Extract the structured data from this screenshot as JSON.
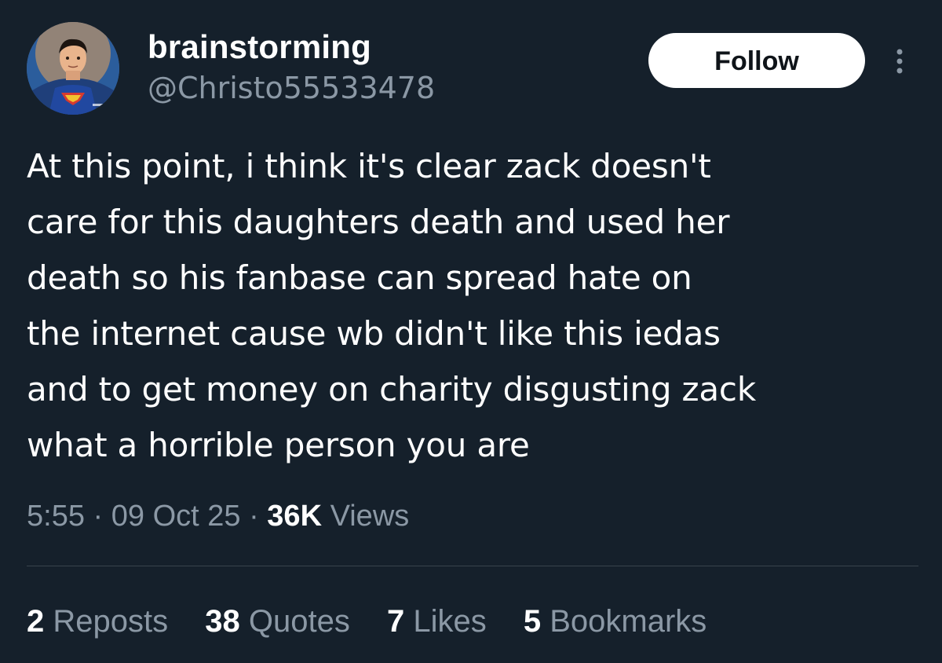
{
  "user": {
    "display_name": "brainstorming",
    "handle": "@Christo55533478",
    "avatar": "superman-avatar"
  },
  "actions": {
    "follow_label": "Follow",
    "more_icon": "more-vertical-icon"
  },
  "tweet": {
    "text": "At this point, i think it's clear zack doesn't\ncare for this daughters death and used her\ndeath so his fanbase can spread hate on\nthe internet cause wb didn't like this iedas\nand to get money on charity disgusting zack\nwhat a horrible person you are"
  },
  "meta": {
    "time": "5:55",
    "sep1": "·",
    "date": "09 Oct 25",
    "sep2": "·",
    "views_count": "36K",
    "views_label": "Views"
  },
  "stats": {
    "reposts_count": "2",
    "reposts_label": "Reposts",
    "quotes_count": "38",
    "quotes_label": "Quotes",
    "likes_count": "7",
    "likes_label": "Likes",
    "bookmarks_count": "5",
    "bookmarks_label": "Bookmarks"
  },
  "colors": {
    "background": "#15202b",
    "secondary_text": "#8b98a5",
    "divider": "#38444d",
    "follow_bg": "#ffffff"
  }
}
